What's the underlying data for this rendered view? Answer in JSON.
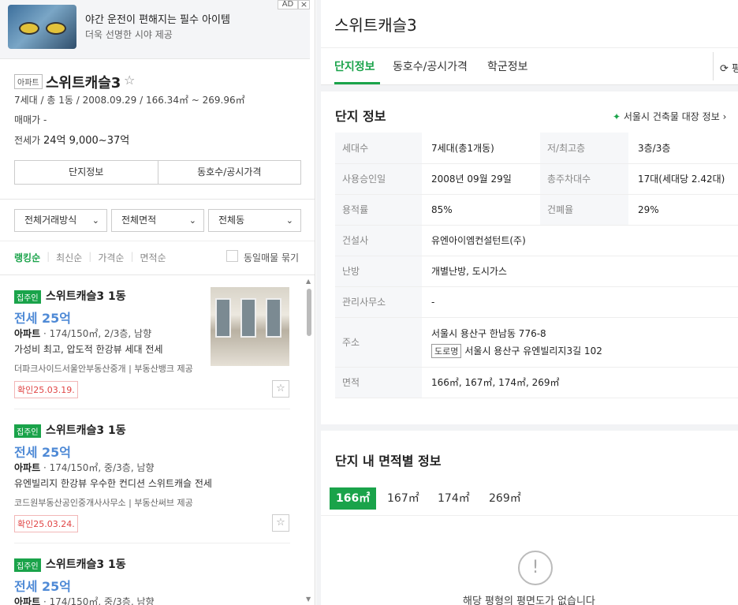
{
  "ad": {
    "title": "야간 운전이 편해지는 필수 아이템",
    "subtitle": "더욱 선명한 시야 제공",
    "badge": "AD",
    "close": "×"
  },
  "complex": {
    "type_tag": "아파트",
    "name": "스위트캐슬3",
    "meta": "7세대 / 총 1동 / 2008.09.29 / 166.34㎡ ~ 269.96㎡",
    "sale_label": "매매가",
    "sale_value": "-",
    "lease_label": "전세가",
    "lease_value": "24억 9,000~37억"
  },
  "left_buttons": [
    "단지정보",
    "동호수/공시가격"
  ],
  "filters": [
    "전체거래방식",
    "전체면적",
    "전체동"
  ],
  "sort_tabs": [
    "랭킹순",
    "최신순",
    "가격순",
    "면적순"
  ],
  "bundle_label": "동일매물 묶기",
  "listings": [
    {
      "owner": "집주인",
      "name": "스위트캐슬3 1동",
      "price": "전세 25억",
      "type": "아파트",
      "spec": "174/150㎡, 2/3층, 남향",
      "desc": "가성비 최고, 압도적 한강뷰 세대 전세",
      "agent": "더파크사이드서울안부동산중개 | 부동산뱅크 제공",
      "confirm": "확인25.03.19."
    },
    {
      "owner": "집주인",
      "name": "스위트캐슬3 1동",
      "price": "전세 25억",
      "type": "아파트",
      "spec": "174/150㎡, 중/3층, 남향",
      "desc": "유엔빌리지 한강뷰 우수한 컨디션 스위트캐슬 전세",
      "agent": "코드원부동산공인중개사사무소 | 부동산써브 제공",
      "confirm": "확인25.03.24."
    },
    {
      "owner": "집주인",
      "name": "스위트캐슬3 1동",
      "price": "전세 25억",
      "type": "아파트",
      "spec": "174/150㎡, 중/3층, 남향"
    }
  ],
  "right": {
    "title": "스위트캐슬3",
    "tabs": [
      "단지정보",
      "동호수/공시가격",
      "학군정보"
    ],
    "refresh": "평"
  },
  "info": {
    "title": "단지 정보",
    "link": "서울시 건축물 대장 정보",
    "rows": {
      "households_label": "세대수",
      "households": "7세대(총1개동)",
      "floors_label": "저/최고층",
      "floors": "3층/3층",
      "approval_label": "사용승인일",
      "approval": "2008년 09월 29일",
      "parking_label": "총주차대수",
      "parking": "17대(세대당 2.42대)",
      "far_label": "용적률",
      "far": "85%",
      "bcr_label": "건폐율",
      "bcr": "29%",
      "builder_label": "건설사",
      "builder": "유엔아이엠컨설턴트(주)",
      "heating_label": "난방",
      "heating": "개별난방, 도시가스",
      "office_label": "관리사무소",
      "office": "-",
      "address_label": "주소",
      "address": "서울시 용산구 한남동 776-8",
      "road_tag": "도로명",
      "road_address": "서울시 용산구 유엔빌리지3길 102",
      "area_label": "면적",
      "area": "166㎡, 167㎡, 174㎡, 269㎡"
    }
  },
  "area_section": {
    "title": "단지 내 면적별 정보",
    "tabs": [
      "166㎡",
      "167㎡",
      "174㎡",
      "269㎡"
    ],
    "empty": "해당 평형의 평면도가 없습니다"
  }
}
